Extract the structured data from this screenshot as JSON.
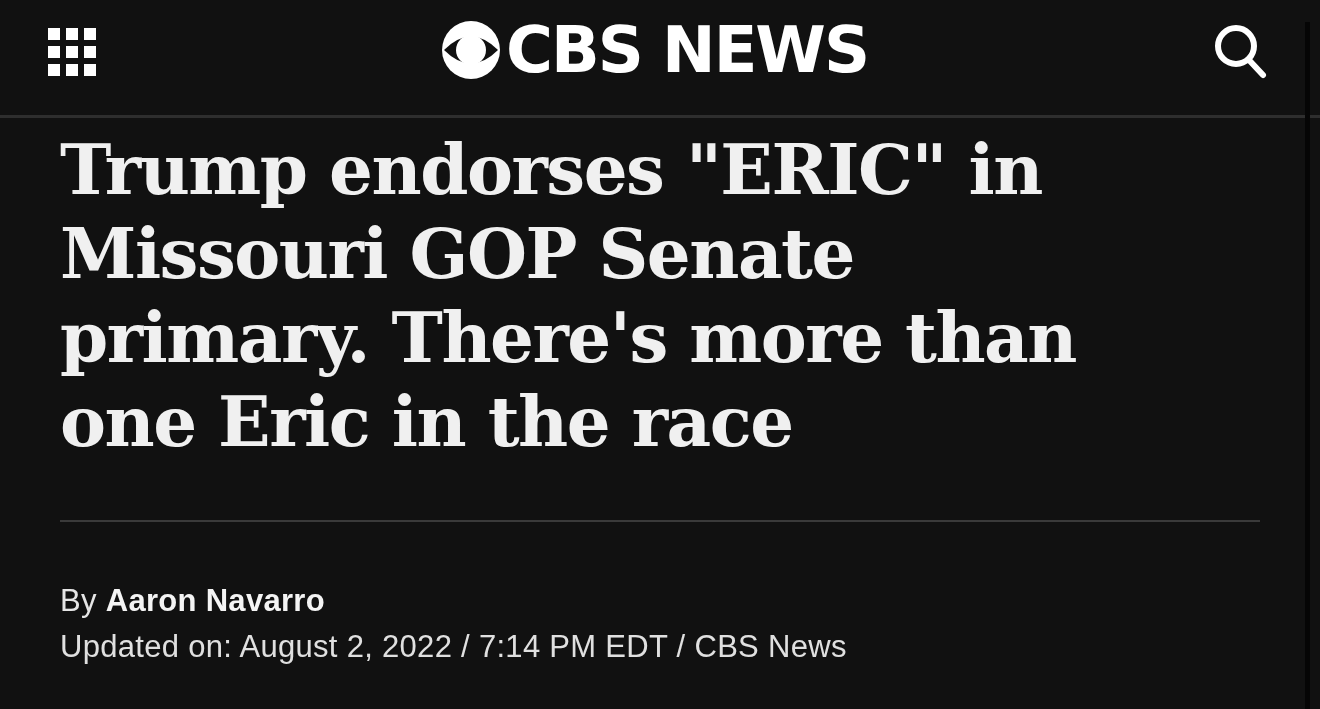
{
  "header": {
    "logo": "CBS NEWS"
  },
  "article": {
    "headline": "Trump endorses \"ERIC\" in Missouri GOP Senate primary. There's more than one Eric in the race",
    "byline": "By **Aaron Navarro**",
    "updated": "Updated on: August 2, 2022 / 7:14 PM EDT / CBS News"
  }
}
